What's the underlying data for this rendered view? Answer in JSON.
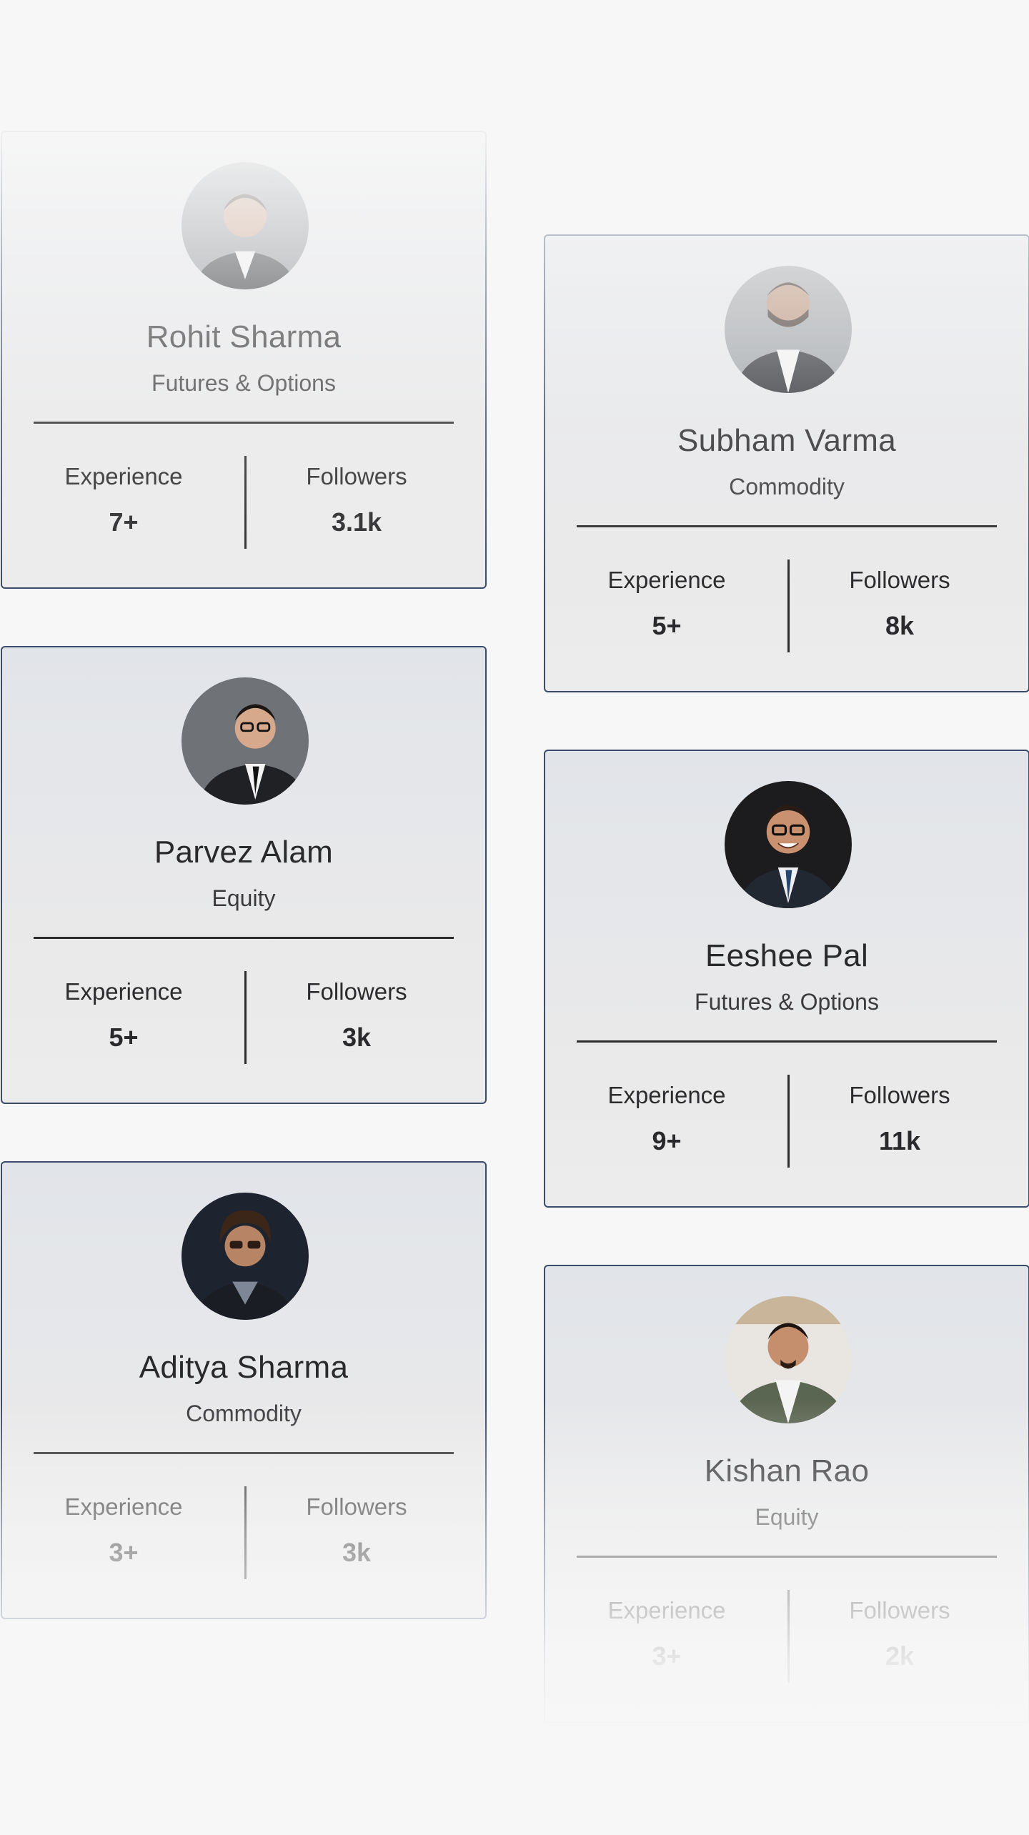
{
  "labels": {
    "experience": "Experience",
    "followers": "Followers"
  },
  "colors": {
    "card_border": "#3a4b6b",
    "card_bg": "#e4e6ea",
    "page_bg": "#f7f7f7"
  },
  "cards": [
    {
      "name": "Rohit Sharma",
      "category": "Futures & Options",
      "experience": "7+",
      "followers": "3.1k",
      "avatar_icon": "person-photo-icon"
    },
    {
      "name": "Subham Varma",
      "category": "Commodity",
      "experience": "5+",
      "followers": "8k",
      "avatar_icon": "person-photo-icon"
    },
    {
      "name": "Parvez Alam",
      "category": "Equity",
      "experience": "5+",
      "followers": "3k",
      "avatar_icon": "person-photo-icon"
    },
    {
      "name": "Eeshee Pal",
      "category": "Futures & Options",
      "experience": "9+",
      "followers": "11k",
      "avatar_icon": "person-photo-icon"
    },
    {
      "name": "Aditya Sharma",
      "category": "Commodity",
      "experience": "3+",
      "followers": "3k",
      "avatar_icon": "person-photo-icon"
    },
    {
      "name": "Kishan Rao",
      "category": "Equity",
      "experience": "3+",
      "followers": "2k",
      "avatar_icon": "person-photo-icon"
    }
  ]
}
